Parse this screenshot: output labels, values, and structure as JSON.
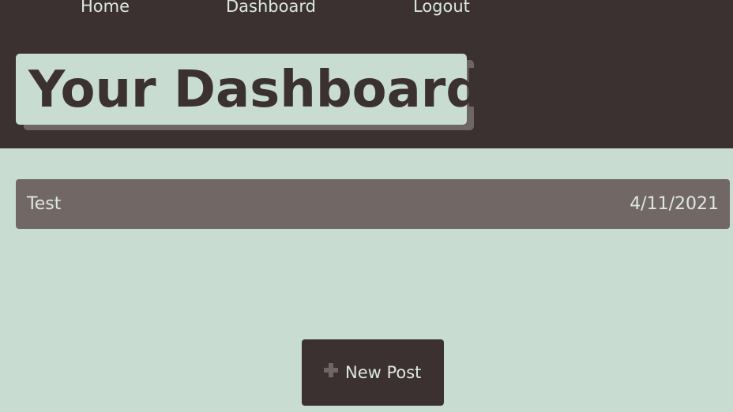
{
  "nav": {
    "home": "Home",
    "dashboard": "Dashboard",
    "logout": "Logout"
  },
  "page": {
    "title": "Your Dashboard"
  },
  "posts": [
    {
      "title": "Test",
      "date": "4/11/2021"
    }
  ],
  "actions": {
    "new_post_label": "New Post",
    "new_post_icon": "plus-icon"
  },
  "colors": {
    "header_bg": "#3a3130",
    "page_bg": "#c8dcd2",
    "post_row_bg": "#716866",
    "text_light": "#dde8e2"
  }
}
